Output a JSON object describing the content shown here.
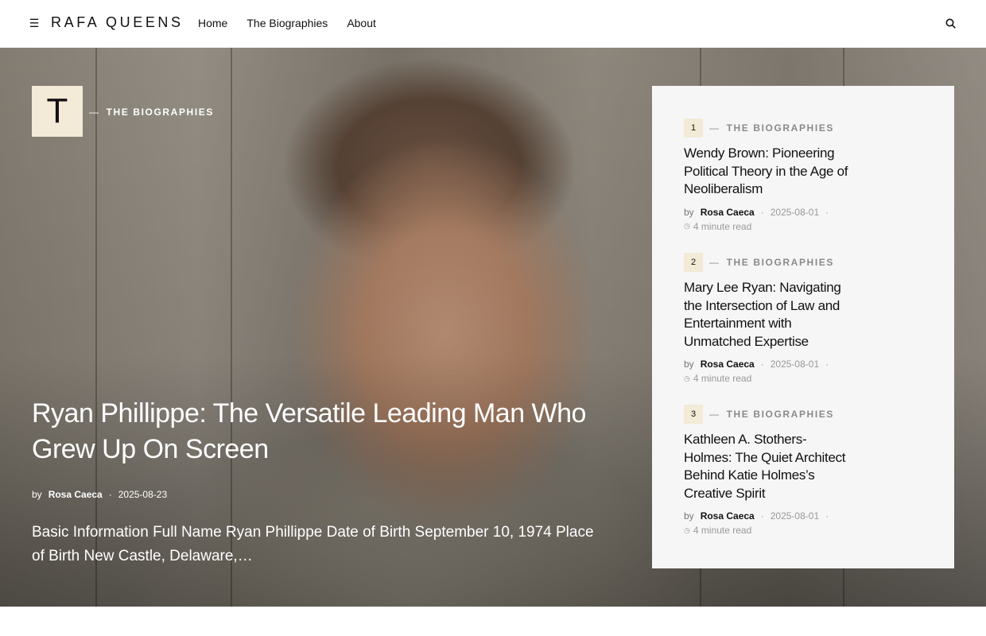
{
  "header": {
    "menu_icon": "hamburger-icon",
    "logo": "RAFA QUEENS",
    "nav": [
      "Home",
      "The Biographies",
      "About"
    ],
    "search_icon": "search-icon"
  },
  "hero": {
    "badge_letter": "T",
    "category": "THE BIOGRAPHIES",
    "title": "Ryan Phillippe: The Versatile Leading Man Who Grew Up On Screen",
    "by": "by",
    "author": "Rosa Caeca",
    "date": "2025-08-23",
    "excerpt": "Basic Information Full Name Ryan Phillippe Date of Birth September 10, 1974 Place of Birth New Castle, Delaware,…"
  },
  "side_posts": [
    {
      "number": "1",
      "category": "THE BIOGRAPHIES",
      "title": "Wendy Brown: Pioneering Political Theory in the Age of Neoliberalism",
      "by": "by",
      "author": "Rosa Caeca",
      "date": "2025-08-01",
      "read_time": "4 minute read"
    },
    {
      "number": "2",
      "category": "THE BIOGRAPHIES",
      "title": "Mary Lee Ryan: Navigating the Intersection of Law and Entertainment with Unmatched Expertise",
      "by": "by",
      "author": "Rosa Caeca",
      "date": "2025-08-01",
      "read_time": "4 minute read"
    },
    {
      "number": "3",
      "category": "THE BIOGRAPHIES",
      "title": "Kathleen A. Stothers-Holmes: The Quiet Architect Behind Katie Holmes’s Creative Spirit",
      "by": "by",
      "author": "Rosa Caeca",
      "date": "2025-08-01",
      "read_time": "4 minute read"
    }
  ],
  "colors": {
    "accent_badge": "#f3ead7",
    "panel_bg": "#f6f6f6",
    "text": "#111111",
    "muted": "#999999"
  }
}
